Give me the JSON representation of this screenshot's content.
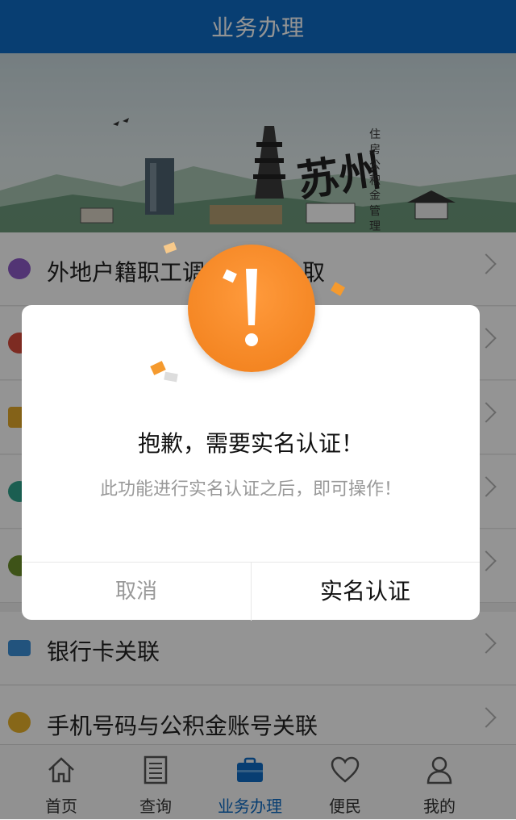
{
  "header": {
    "title": "业务办理"
  },
  "banner": {
    "calligraphy": "苏州",
    "vertical_text": "住房公积金管理中心"
  },
  "list": {
    "rows": [
      {
        "label": "外地户籍职工调",
        "label_tail": "取",
        "icon": "purple-circle-icon",
        "color": "#8d5ac8"
      },
      {
        "label": "",
        "icon": "red-circle-icon",
        "color": "#d84a3c"
      },
      {
        "label": "",
        "icon": "gold-coin-icon",
        "color": "#e3a92a"
      },
      {
        "label": "",
        "icon": "teal-circle-icon",
        "color": "#2fa38c"
      },
      {
        "label": "",
        "icon": "olive-circle-icon",
        "color": "#6b8f2a"
      },
      {
        "label": "银行卡关联",
        "icon": "bank-card-icon",
        "color": "#3b8fd8"
      },
      {
        "label": "手机号码与公积金账号关联",
        "icon": "money-bag-icon",
        "color": "#e9b12a"
      }
    ]
  },
  "dialog": {
    "title": "抱歉，需要实名认证！",
    "message": "此功能进行实名认证之后，即可操作！",
    "cancel_label": "取消",
    "confirm_label": "实名认证"
  },
  "tabbar": {
    "tabs": [
      {
        "label": "首页",
        "icon": "home-icon"
      },
      {
        "label": "查询",
        "icon": "document-icon"
      },
      {
        "label": "业务办理",
        "icon": "briefcase-icon",
        "active": true
      },
      {
        "label": "便民",
        "icon": "heart-icon"
      },
      {
        "label": "我的",
        "icon": "user-icon"
      }
    ]
  },
  "colors": {
    "header": "#0e6cc4",
    "alert": "#f48a24",
    "active_tab": "#0e6cc4"
  }
}
